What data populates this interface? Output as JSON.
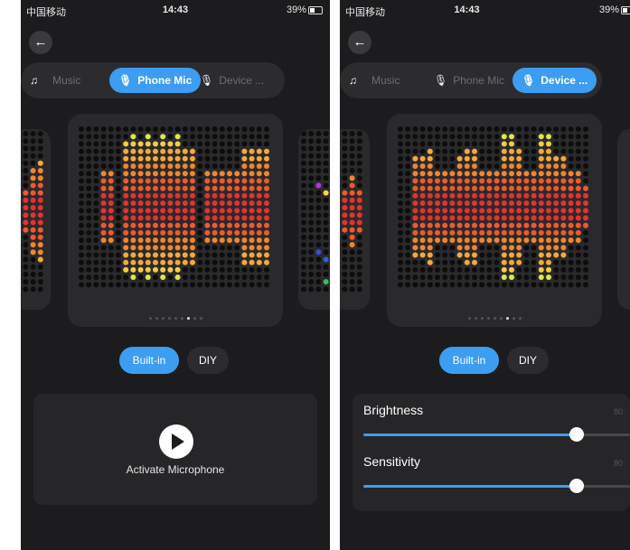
{
  "status": {
    "left": {
      "carrier": "中国移动",
      "time": "14:43",
      "battery": "39%"
    },
    "right": {
      "carrier": "中国移动",
      "time": "14:43",
      "battery": "39%"
    }
  },
  "colors": {
    "accent": "#3d9df2",
    "background": "#1c1c1e",
    "card": "#2a2a2c"
  },
  "icons": {
    "back": "arrow-left-icon",
    "music": "music-note-icon",
    "mic": "microphone-icon",
    "play": "play-icon"
  },
  "left": {
    "modes": {
      "music": "Music",
      "phone_mic": "Phone Mic",
      "device": "Device ..."
    },
    "tabs": {
      "builtin": "Built-in",
      "diy": "DIY"
    },
    "activate_label": "Activate Microphone",
    "pager": {
      "count": 9,
      "active": 6
    }
  },
  "right": {
    "modes": {
      "music": "Music",
      "phone_mic": "Phone Mic",
      "device": "Device ..."
    },
    "tabs": {
      "builtin": "Built-in",
      "diy": "DIY"
    },
    "brightness": {
      "label": "Brightness",
      "value": "80",
      "level": 0.8
    },
    "sensitivity": {
      "label": "Sensitivity",
      "value": "80",
      "level": 0.8
    },
    "pager": {
      "count": 9,
      "active": 6
    }
  },
  "visualizer": {
    "left_heights": [
      0,
      0,
      0,
      10,
      10,
      0,
      18,
      20,
      18,
      20,
      18,
      20,
      18,
      20,
      16,
      16,
      0,
      10,
      10,
      10,
      10,
      10,
      16,
      16,
      16,
      16
    ],
    "right_heights": [
      0,
      0,
      14,
      14,
      16,
      10,
      10,
      10,
      14,
      16,
      16,
      10,
      10,
      10,
      20,
      20,
      16,
      10,
      10,
      20,
      20,
      14,
      14,
      10,
      10,
      6
    ]
  }
}
